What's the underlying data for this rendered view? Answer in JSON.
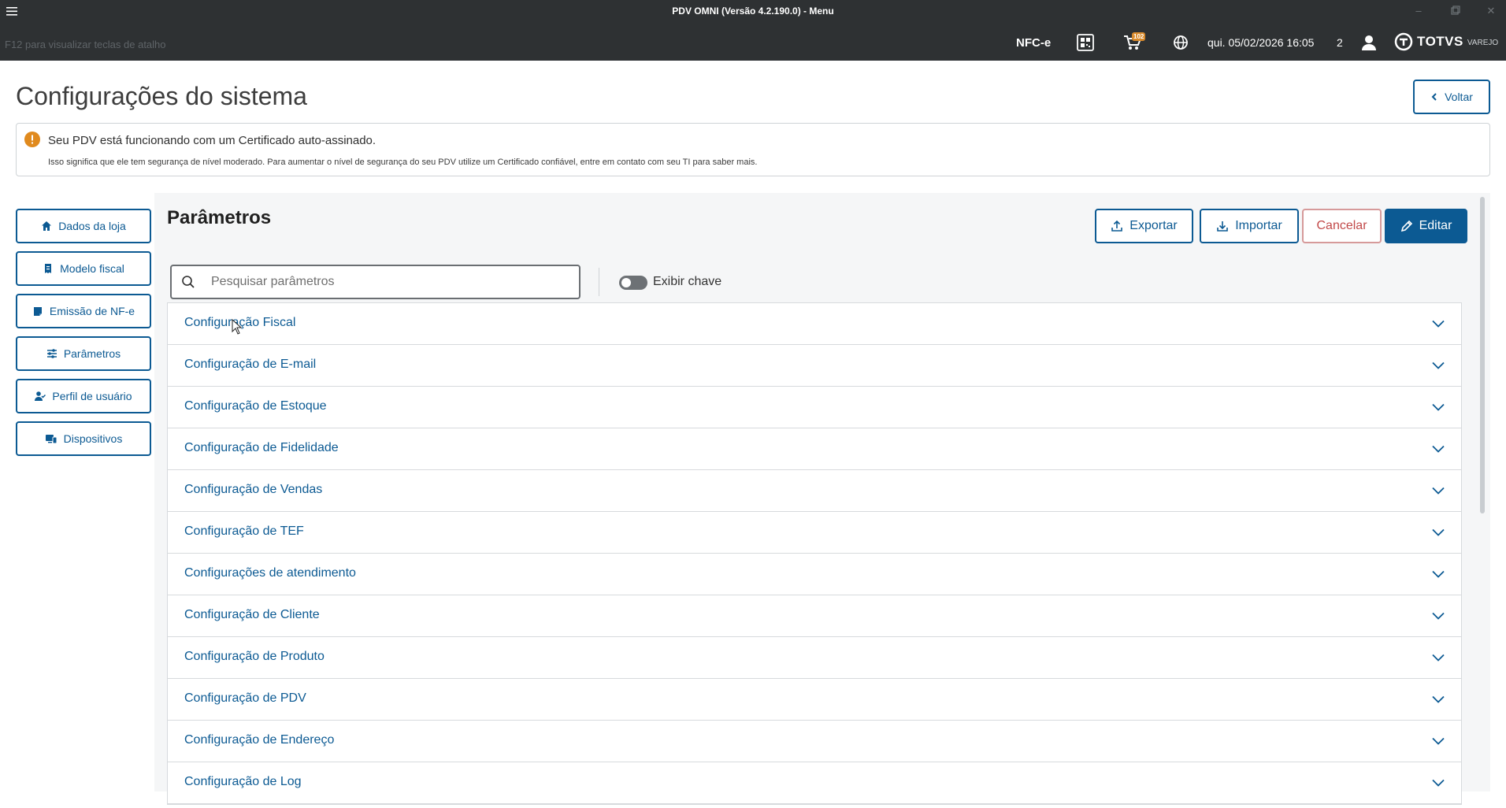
{
  "window": {
    "title": "PDV OMNI (Versão 4.2.190.0) - Menu"
  },
  "topbar": {
    "shortcut_hint": "F12 para visualizar teclas de atalho",
    "doc_type": "NFC-e",
    "cart_badge": "102",
    "datetime": "qui. 05/02/2026 16:05",
    "user_count": "2",
    "brand_name": "TOTVS",
    "brand_sub": "VAREJO"
  },
  "page": {
    "title": "Configurações do sistema",
    "back_label": "Voltar"
  },
  "alert": {
    "title": "Seu PDV está funcionando com um Certificado auto-assinado.",
    "detail": "Isso significa que ele tem segurança de nível moderado. Para aumentar o nível de segurança do seu PDV utilize um Certificado confiável, entre em contato com seu TI para saber mais.",
    "color": "#e08a1e"
  },
  "sidebar": {
    "items": [
      {
        "label": "Dados da loja",
        "icon": "home-icon"
      },
      {
        "label": "Modelo fiscal",
        "icon": "receipt-icon"
      },
      {
        "label": "Emissão de NF-e",
        "icon": "document-icon"
      },
      {
        "label": "Parâmetros",
        "icon": "sliders-icon"
      },
      {
        "label": "Perfil de usuário",
        "icon": "user-check-icon"
      },
      {
        "label": "Dispositivos",
        "icon": "devices-icon"
      }
    ]
  },
  "panel": {
    "title": "Parâmetros",
    "export_label": "Exportar",
    "import_label": "Importar",
    "cancel_label": "Cancelar",
    "edit_label": "Editar",
    "search_placeholder": "Pesquisar parâmetros",
    "toggle_label": "Exibir chave",
    "toggle_on": false
  },
  "sections": [
    "Configuração Fiscal",
    "Configuração de E-mail",
    "Configuração de Estoque",
    "Configuração de Fidelidade",
    "Configuração de Vendas",
    "Configuração de TEF",
    "Configurações de atendimento",
    "Configuração de Cliente",
    "Configuração de Produto",
    "Configuração de PDV",
    "Configuração de Endereço",
    "Configuração de Log"
  ],
  "colors": {
    "primary": "#0c5a93",
    "header_bg": "#2e3133",
    "danger": "#c24a4a"
  }
}
